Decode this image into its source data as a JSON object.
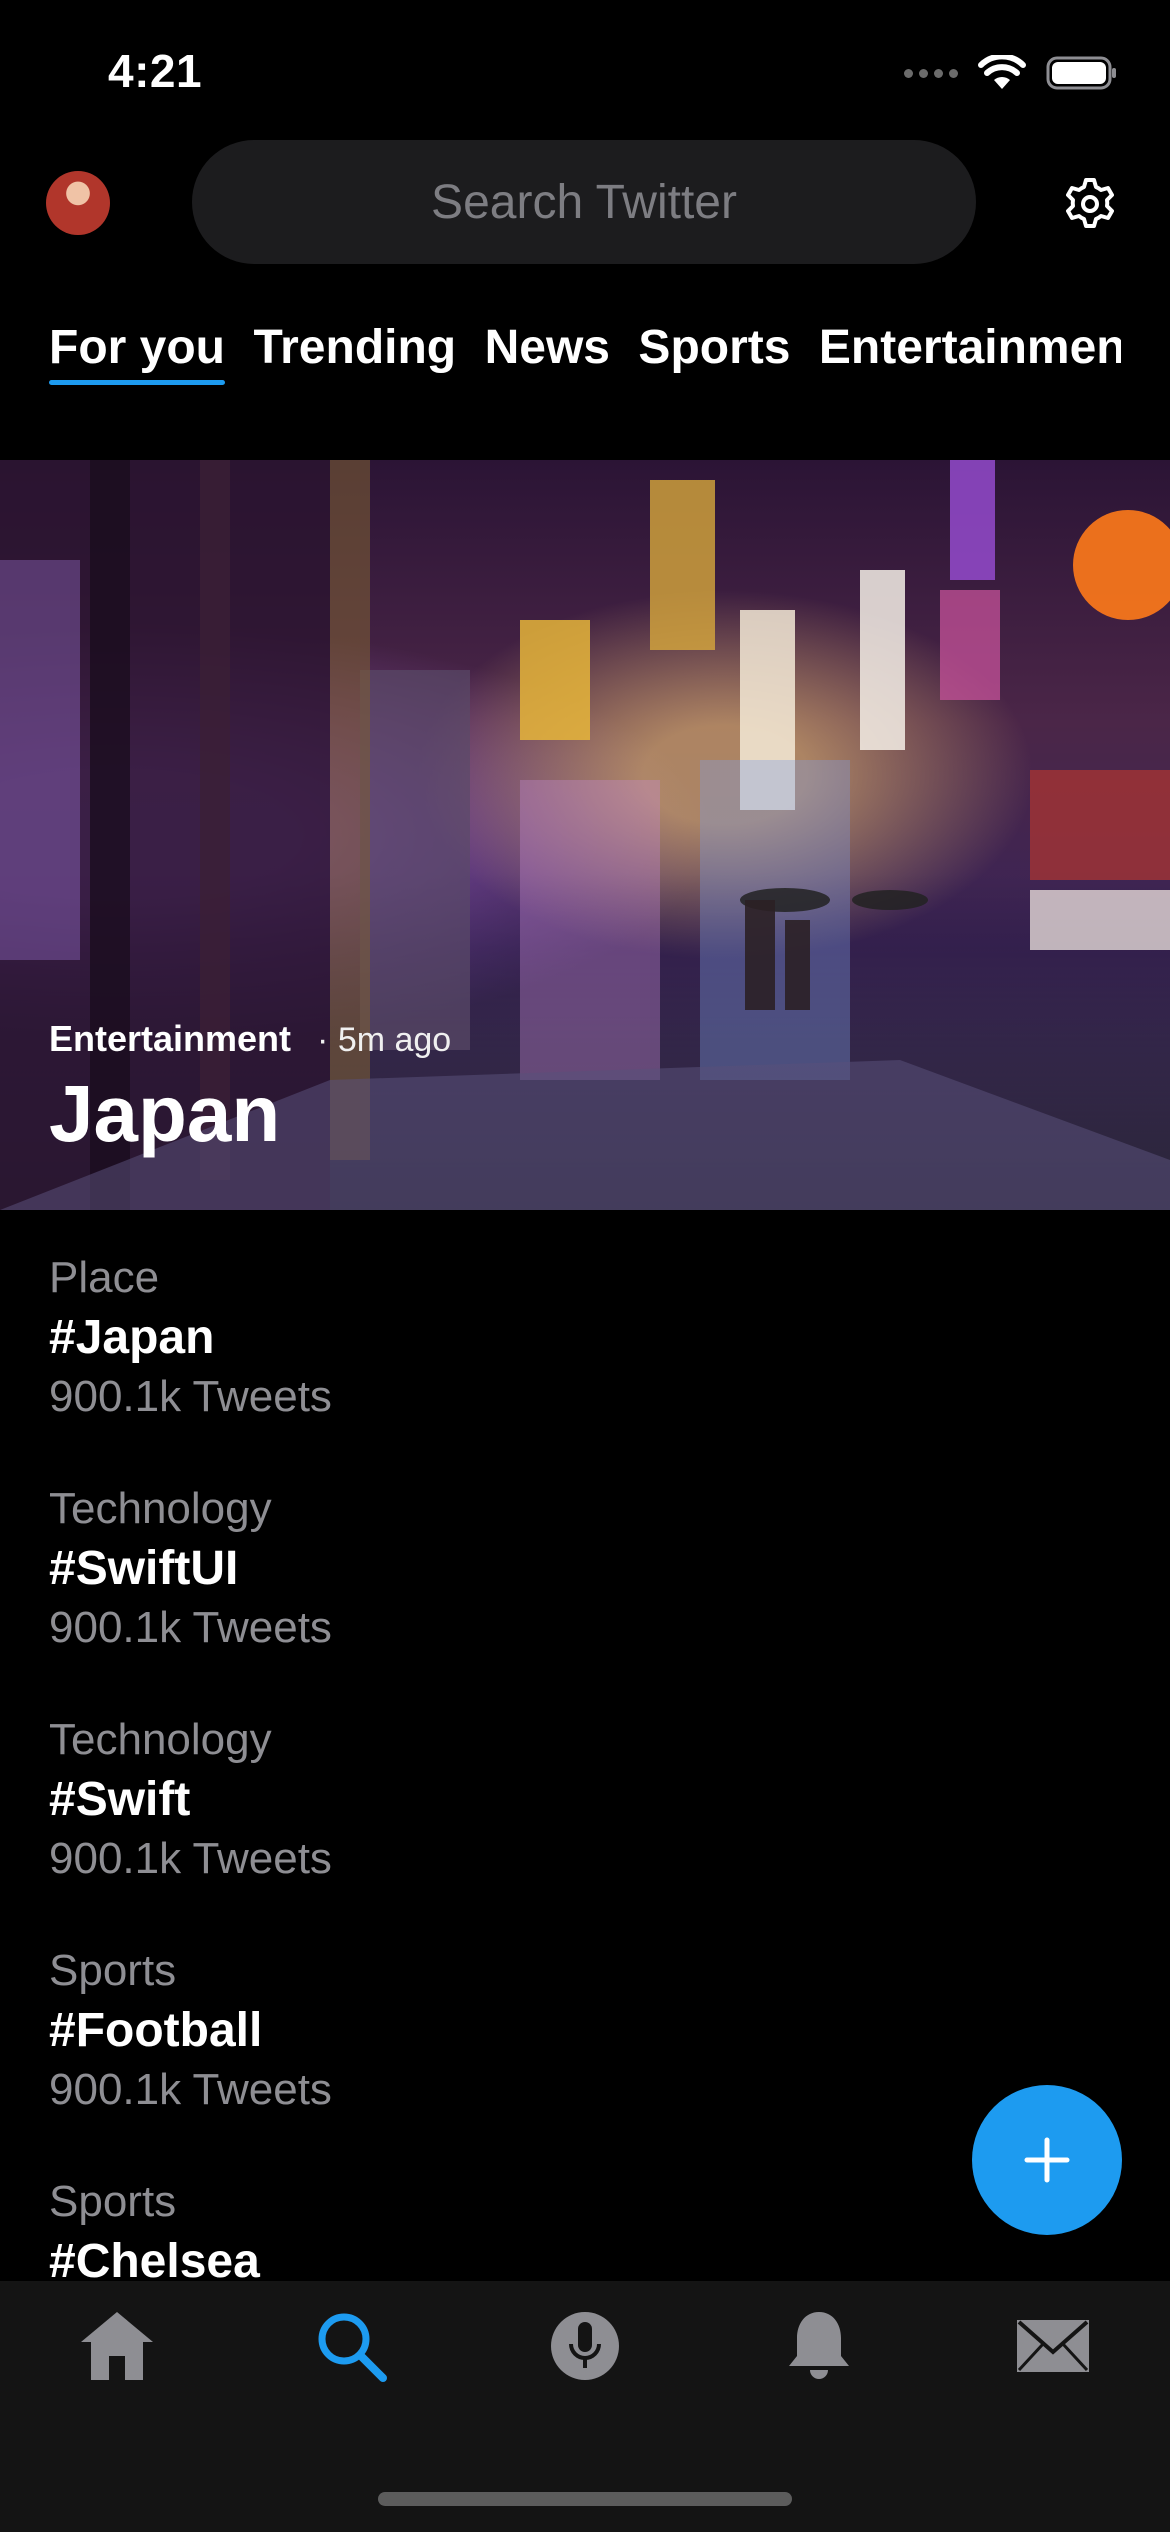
{
  "status_bar": {
    "time": "4:21"
  },
  "header": {
    "search_placeholder": "Search Twitter"
  },
  "tabs": [
    {
      "label": "For you",
      "active": true
    },
    {
      "label": "Trending",
      "active": false
    },
    {
      "label": "News",
      "active": false
    },
    {
      "label": "Sports",
      "active": false
    },
    {
      "label": "Entertainment",
      "active": false
    }
  ],
  "hero": {
    "category": "Entertainment",
    "time": "· 5m ago",
    "title": "Japan"
  },
  "trends": [
    {
      "category": "Place",
      "tag": "#Japan",
      "count": "900.1k Tweets"
    },
    {
      "category": "Technology",
      "tag": "#SwiftUI",
      "count": "900.1k Tweets"
    },
    {
      "category": "Technology",
      "tag": "#Swift",
      "count": "900.1k Tweets"
    },
    {
      "category": "Sports",
      "tag": "#Football",
      "count": "900.1k Tweets"
    },
    {
      "category": "Sports",
      "tag": "#Chelsea",
      "count": ""
    }
  ],
  "tab_bar": {
    "items": [
      "home-icon",
      "search-icon",
      "spaces-icon",
      "notifications-icon",
      "messages-icon"
    ],
    "active_color": "#1d9bf0",
    "inactive_color": "#8e8e93"
  },
  "colors": {
    "accent": "#1d9bf0",
    "background": "#000000"
  }
}
